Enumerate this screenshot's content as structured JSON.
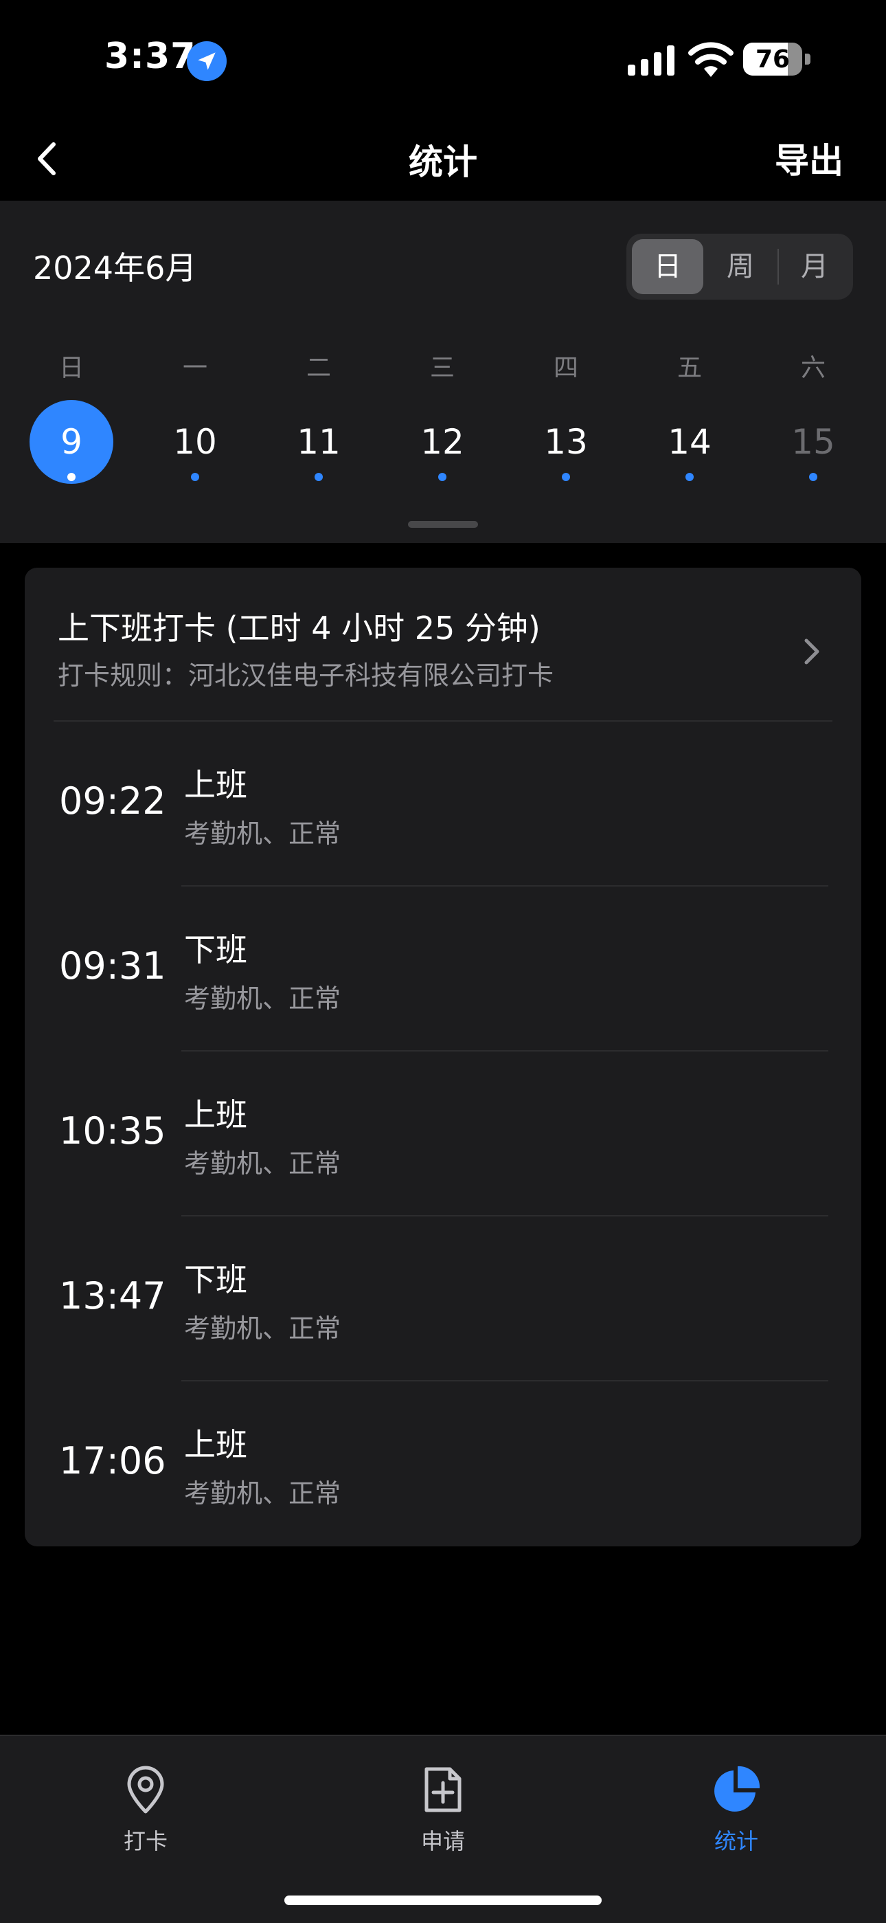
{
  "status_bar": {
    "time": "3:37",
    "battery": "76",
    "battery_level": 0.76
  },
  "nav": {
    "title": "统计",
    "export_label": "导出"
  },
  "calendar": {
    "month_label": "2024年6月",
    "view_modes": [
      "日",
      "周",
      "月"
    ],
    "active_mode": "日",
    "weekdays": [
      "日",
      "一",
      "二",
      "三",
      "四",
      "五",
      "六"
    ],
    "days": [
      "9",
      "10",
      "11",
      "12",
      "13",
      "14",
      "15"
    ],
    "selected_day": "9"
  },
  "card": {
    "title": "上下班打卡 (工时 4 小时 25 分钟)",
    "rule": "打卡规则：河北汉佳电子科技有限公司打卡",
    "records": [
      {
        "time": "09:22",
        "type": "上班",
        "detail": "考勤机、正常"
      },
      {
        "time": "09:31",
        "type": "下班",
        "detail": "考勤机、正常"
      },
      {
        "time": "10:35",
        "type": "上班",
        "detail": "考勤机、正常"
      },
      {
        "time": "13:47",
        "type": "下班",
        "detail": "考勤机、正常"
      },
      {
        "time": "17:06",
        "type": "上班",
        "detail": "考勤机、正常"
      }
    ]
  },
  "tabs": [
    {
      "label": "打卡",
      "icon": "location-pin-icon"
    },
    {
      "label": "申请",
      "icon": "add-document-icon"
    },
    {
      "label": "统计",
      "icon": "pie-chart-icon",
      "active": true
    }
  ],
  "colors": {
    "accent": "#2f86ff",
    "panel": "#1c1c1e",
    "background": "#000000"
  }
}
